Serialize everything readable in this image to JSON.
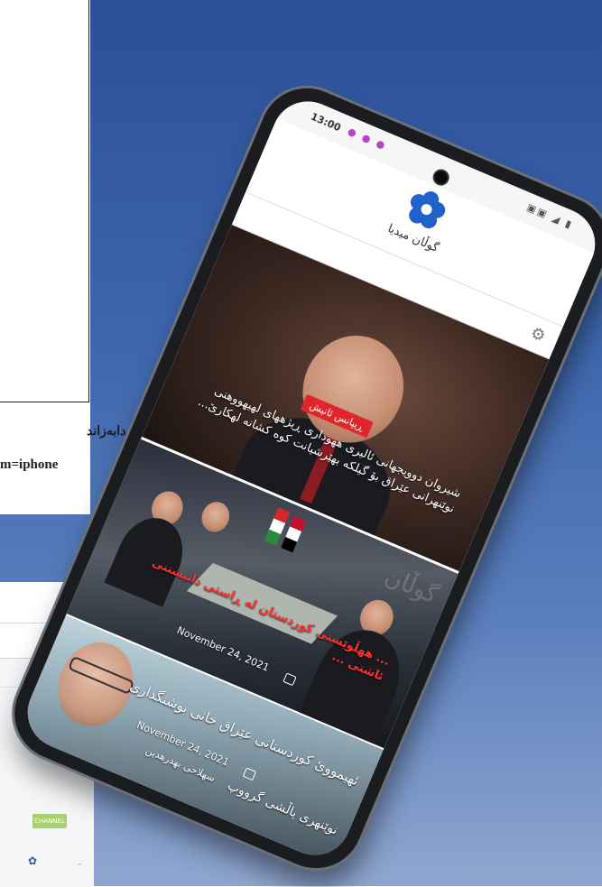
{
  "page": {
    "caption_kurdish": "بۆ دابەزاند",
    "caption_query": "m=iphone"
  },
  "peek": {
    "chip_label": "CHANNEL"
  },
  "phone": {
    "status": {
      "time": "13:00",
      "notifications": "● ● ●",
      "system_icons": "▣▣ ◢ ▮"
    },
    "header": {
      "logo_text": "گوڵان میدیا"
    },
    "articles": [
      {
        "tag": "ڕیپانس ئانیش",
        "title": "شیروان دوویجهانی ئالیری ههوداری ڕیژههای لهیهووهنی نوێنهرانی عێراق بۆ گیلکه بهێرشیانت کوه کشانه لهکارێ..."
      },
      {
        "title": "... ههڵوێستی کوردستان له ڕاستی دانیشتنی ئاشتی ...",
        "date": "November 24, 2021",
        "watermark": "گوڵان"
      },
      {
        "title": "ئهیمووئ کوردستانی عێراق خانی بوشنگداری",
        "subtitle": "نوێنهری پاڵشی گرووپ",
        "date": "November 24, 2021",
        "author": "سهلاحی بهدرهدین"
      }
    ]
  },
  "colors": {
    "background_top": "#2c4f97",
    "background_bottom": "#8fa6cf",
    "accent_red": "#e0262c",
    "logo_blue": "#1f62c9"
  }
}
